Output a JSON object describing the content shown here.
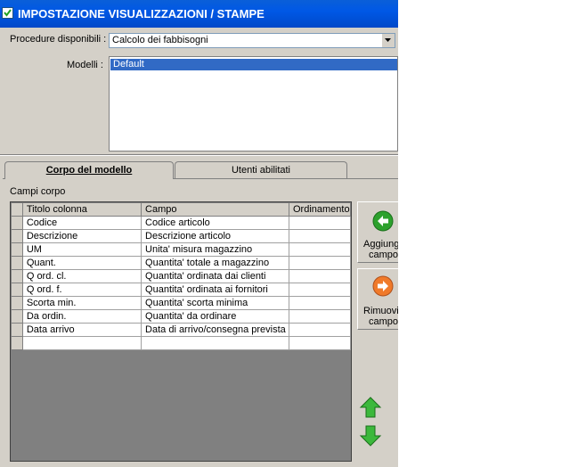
{
  "window": {
    "title": "IMPOSTAZIONE VISUALIZZAZIONI / STAMPE"
  },
  "procedure": {
    "label": "Procedure disponibili :",
    "selected": "Calcolo dei fabbisogni"
  },
  "models": {
    "label": "Modelli :",
    "items": [
      "Default"
    ]
  },
  "tabs": [
    {
      "label": "Corpo del modello"
    },
    {
      "label": "Utenti abilitati"
    }
  ],
  "section": {
    "label": "Campi corpo"
  },
  "grid": {
    "columns": [
      "Titolo colonna",
      "Campo",
      "Ordinamento"
    ],
    "rows": [
      [
        "Codice",
        "Codice articolo",
        ""
      ],
      [
        "Descrizione",
        "Descrizione articolo",
        ""
      ],
      [
        "UM",
        "Unita' misura magazzino",
        ""
      ],
      [
        "Quant.",
        "Quantita' totale a magazzino",
        ""
      ],
      [
        "Q ord. cl.",
        "Quantita' ordinata dai clienti",
        ""
      ],
      [
        "Q ord. f.",
        "Quantita' ordinata ai fornitori",
        ""
      ],
      [
        "Scorta min.",
        "Quantita' scorta minima",
        ""
      ],
      [
        "Da ordin.",
        "Quantita' da ordinare",
        ""
      ],
      [
        "Data arrivo",
        "Data di arrivo/consegna prevista",
        ""
      ],
      [
        "",
        "",
        ""
      ]
    ]
  },
  "buttons": {
    "add_line1": "Aggiung",
    "add_line2": "campo",
    "remove_line1": "Rimuovi",
    "remove_line2": "campo"
  },
  "icons": {
    "add": "green-left-arrow-icon",
    "remove": "orange-right-arrow-icon",
    "up": "green-up-arrow-icon",
    "down": "green-down-arrow-icon"
  },
  "colors": {
    "titlebar": "#0058e6",
    "selection": "#316ac5",
    "face": "#d4d0c8",
    "grid_empty": "#808080"
  }
}
